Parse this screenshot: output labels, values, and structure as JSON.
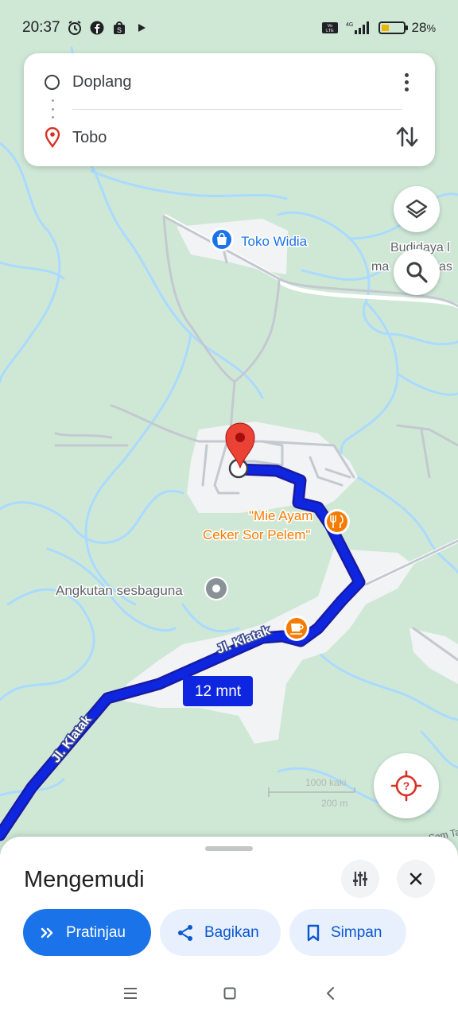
{
  "status_bar": {
    "time": "20:37",
    "battery_percent": "28",
    "battery_symbol": "%",
    "network": "4G",
    "volte": "Vo LTE",
    "icons": [
      "alarm-icon",
      "facebook-icon",
      "shopping-bag-icon",
      "play-icon"
    ]
  },
  "route": {
    "origin": "Doplang",
    "destination": "Tobo"
  },
  "map": {
    "places": {
      "shop": "Toko Widia",
      "restaurant_line1": "\"Mie Ayam",
      "restaurant_line2": "Ceker Sor Pelem\"",
      "transport": "Angkutan sesbaguna",
      "partial_line1": "Budidaya l",
      "partial_line2": "ma",
      "partial_line2b": "as",
      "partial_bottom": "Sem Ta"
    },
    "roads": {
      "road_a": "Jl. Klatak",
      "road_b": "Jl. Klatak"
    },
    "duration_badge": "12 mnt",
    "scale": {
      "imperial": "1000 kaki",
      "metric": "200 m"
    },
    "colors": {
      "land": "#cfe8d6",
      "water": "#aadaff",
      "route": "#0f26e0",
      "route_outline": "#1a1aa0",
      "built_area": "#f1f3f4",
      "poi_orange": "#f57c00",
      "poi_blue": "#1a73e8",
      "pin_red": "#ea4335"
    }
  },
  "sheet": {
    "title": "Mengemudi",
    "preview_label": "Pratinjau",
    "share_label": "Bagikan",
    "save_label": "Simpan"
  }
}
